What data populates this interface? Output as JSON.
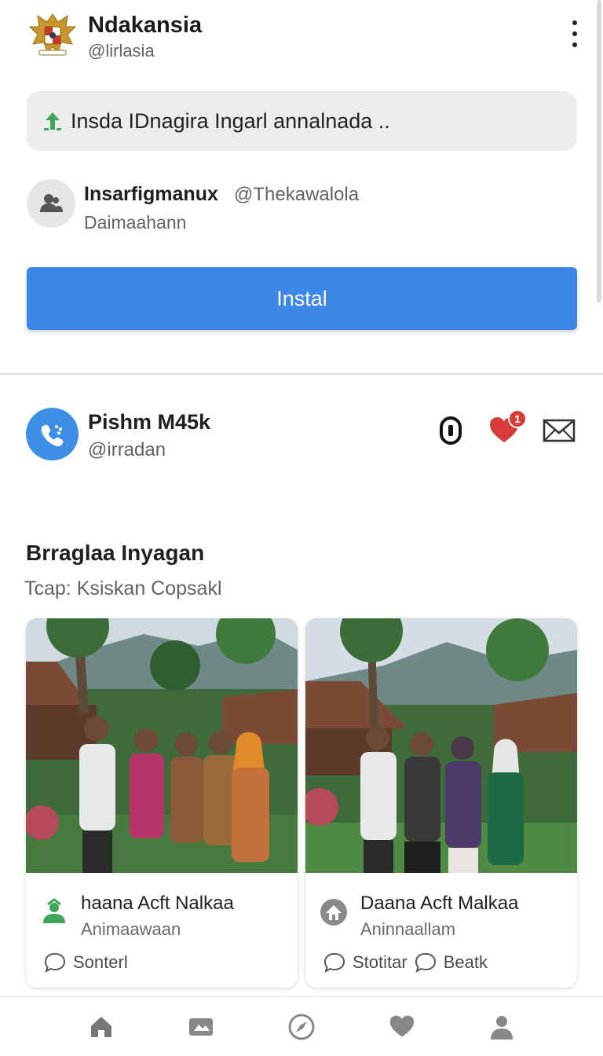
{
  "header": {
    "title": "Ndakansia",
    "handle": "@lirlasia",
    "logo_icon": "garuda-emblem-logo",
    "menu_icon": "kebab-menu-icon"
  },
  "banner": {
    "icon": "upload-arrow-icon",
    "text": "Insda IDnagira Ingarl annalnada .."
  },
  "author": {
    "avatar_icon": "user-group-icon",
    "name": "Insarfigmanux",
    "handle": "@Thekawalola",
    "subtitle": "Daimaahann"
  },
  "install_button": {
    "label": "Instal"
  },
  "profile": {
    "avatar_icon": "phone-call-icon",
    "name": "Pishm M45k",
    "handle": "@irradan",
    "actions": [
      {
        "icon": "zero-outline-icon"
      },
      {
        "icon": "heart-icon",
        "badge": "1"
      },
      {
        "icon": "mail-icon"
      }
    ]
  },
  "section": {
    "title": "Brraglaa Inyagan",
    "subtitle": "Tcap: Ksiskan Copsakl"
  },
  "cards": [
    {
      "photo": "group-photo-village",
      "icon": "green-people-icon",
      "title": "haana Aᴄft Nalkaa",
      "subtitle": "Animaawaan",
      "actions": [
        "Sonterl"
      ]
    },
    {
      "photo": "group-photo-village",
      "icon": "gray-home-icon",
      "title": "Daana Aᴄft Malkaa",
      "subtitle": "Aninnaallam",
      "actions": [
        "Stotitar",
        "Beatk"
      ]
    }
  ],
  "bottom_nav": {
    "items": [
      {
        "icon": "home-icon"
      },
      {
        "icon": "photo-card-icon"
      },
      {
        "icon": "compass-icon"
      },
      {
        "icon": "heart-icon"
      },
      {
        "icon": "profile-icon"
      }
    ]
  },
  "colors": {
    "accent": "#3d87e8",
    "badge": "#d93b3b",
    "heart": "#d93b3b",
    "green_icon": "#3fa558"
  }
}
